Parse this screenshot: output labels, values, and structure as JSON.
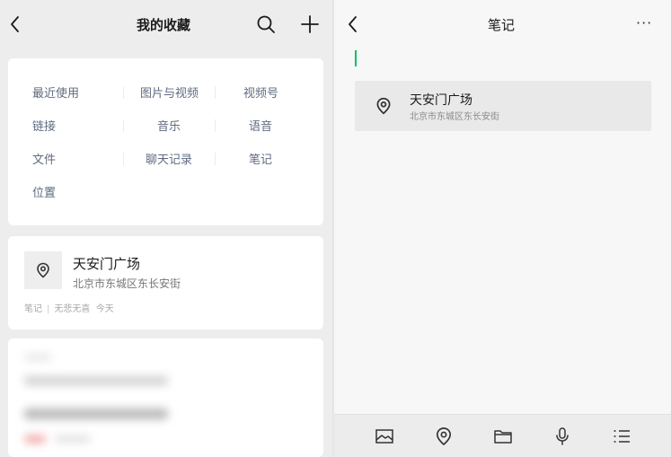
{
  "left": {
    "header": {
      "title": "我的收藏",
      "back_icon": "chevron-left-icon",
      "search_icon": "search-icon",
      "add_icon": "plus-icon"
    },
    "categories": [
      "最近使用",
      "图片与视频",
      "视频号",
      "链接",
      "音乐",
      "语音",
      "文件",
      "聊天记录",
      "笔记",
      "位置"
    ],
    "favorite": {
      "name": "天安门广场",
      "address": "北京市东城区东长安街",
      "type": "笔记",
      "separator": "|",
      "source": "无悲无喜",
      "time": "今天",
      "icon": "location-pin-icon"
    }
  },
  "right": {
    "header": {
      "title": "笔记",
      "back_icon": "chevron-left-icon",
      "more_label": "···"
    },
    "location": {
      "name": "天安门广场",
      "address": "北京市东城区东长安街",
      "icon": "location-pin-icon"
    },
    "toolbar": [
      "image-icon",
      "location-pin-icon",
      "folder-icon",
      "microphone-icon",
      "list-icon"
    ]
  },
  "colors": {
    "accent": "#07c160",
    "category_text": "#5f6b80",
    "background": "#ededed"
  }
}
